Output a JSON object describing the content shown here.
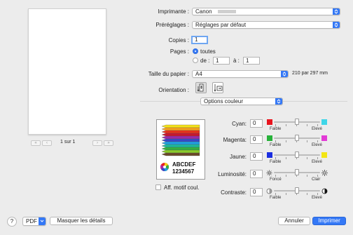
{
  "preview": {
    "page_label": "1 sur 1"
  },
  "printer": {
    "label": "Imprimante :",
    "value": "Canon"
  },
  "presets": {
    "label": "Préréglages :",
    "value": "Réglages par défaut"
  },
  "copies": {
    "label": "Copies :",
    "value": "1"
  },
  "pages": {
    "label": "Pages :",
    "all_label": "toutes",
    "range_from_label": "de :",
    "range_from_value": "1",
    "range_to_label": "à :",
    "range_to_value": "1"
  },
  "paper": {
    "label": "Taille du papier :",
    "value": "A4",
    "dimensions": "210 par 297 mm"
  },
  "orientation": {
    "label": "Orientation :"
  },
  "options": {
    "value": "Options couleur"
  },
  "sample": {
    "line1": "ABCDEF",
    "line2": "1234567"
  },
  "show_pattern": {
    "label": "Aff. motif coul."
  },
  "adjustments": [
    {
      "label": "Cyan:",
      "value": "0",
      "left_word": "Faible",
      "right_word": "Elevé",
      "left_color": "#e8141e",
      "right_color": "#3fd6e8"
    },
    {
      "label": "Magenta:",
      "value": "0",
      "left_word": "Faible",
      "right_word": "Elevé",
      "left_color": "#27b23a",
      "right_color": "#e23ad6"
    },
    {
      "label": "Jaune:",
      "value": "0",
      "left_word": "Faible",
      "right_word": "Elevé",
      "left_color": "#1b2ee0",
      "right_color": "#f3e515"
    },
    {
      "label": "Luminosité:",
      "value": "0",
      "left_word": "Foncé",
      "right_word": "Clair",
      "left_icon": "sun-dim-icon",
      "right_icon": "sun-bright-icon"
    },
    {
      "label": "Contraste:",
      "value": "0",
      "left_word": "Faible",
      "right_word": "Elevé",
      "left_icon": "contrast-low-icon",
      "right_icon": "contrast-high-icon"
    }
  ],
  "footer": {
    "help": "?",
    "pdf": "PDF",
    "hide_details": "Masquer les détails",
    "cancel": "Annuler",
    "print": "Imprimer"
  },
  "colors": {
    "accent": "#3478f6"
  }
}
